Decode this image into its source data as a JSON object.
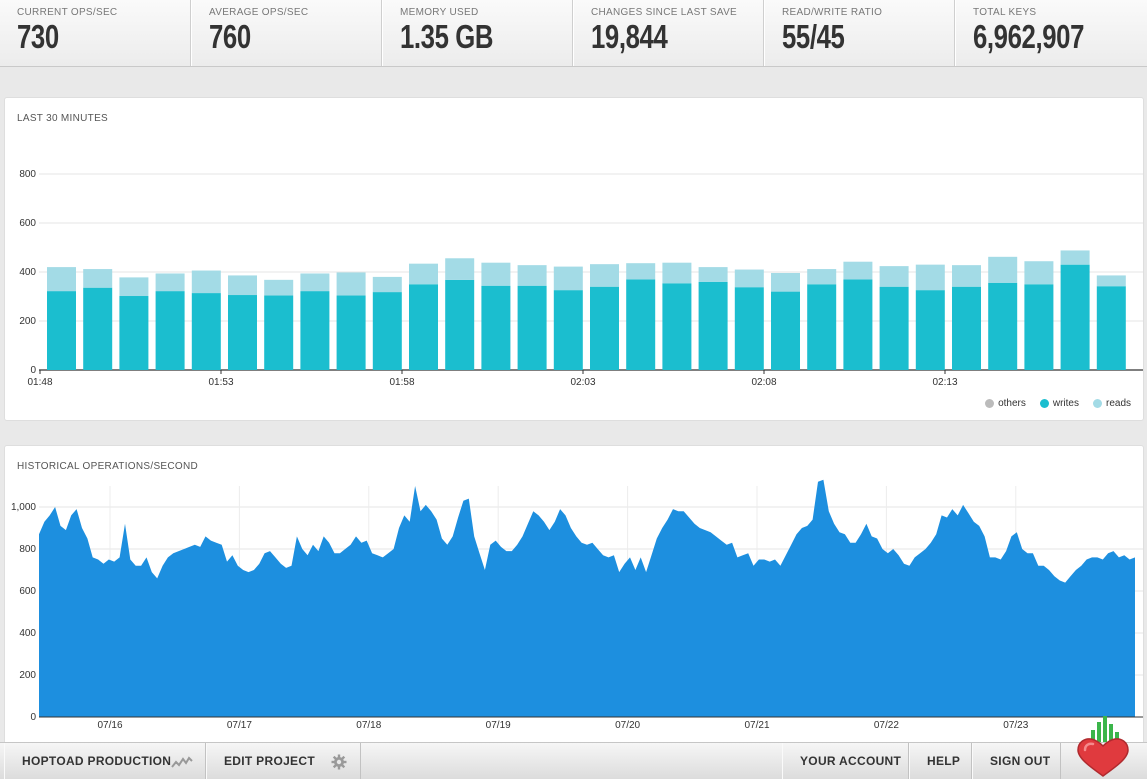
{
  "stats": [
    {
      "label": "CURRENT OPS/SEC",
      "value": "730"
    },
    {
      "label": "AVERAGE OPS/SEC",
      "value": "760"
    },
    {
      "label": "MEMORY USED",
      "value": "1.35 GB"
    },
    {
      "label": "CHANGES SINCE LAST SAVE",
      "value": "19,844"
    },
    {
      "label": "READ/WRITE RATIO",
      "value": "55/45"
    },
    {
      "label": "TOTAL KEYS",
      "value": "6,962,907"
    }
  ],
  "colors": {
    "writes": "#1bbecf",
    "reads": "#a3dbe6",
    "others": "#bbbbbb",
    "historical": "#1d8fdf"
  },
  "chart_data": [
    {
      "type": "bar",
      "title": "LAST 30 MINUTES",
      "stacked": true,
      "ylim": [
        0,
        800
      ],
      "yticks": [
        "0",
        "200",
        "400",
        "600",
        "800"
      ],
      "xtick_labels": [
        "01:48",
        "01:53",
        "01:58",
        "02:03",
        "02:08",
        "02:13"
      ],
      "legend": [
        "others",
        "writes",
        "reads"
      ],
      "legend_position": "bottom-right",
      "grid": true,
      "series": [
        {
          "name": "writes",
          "values": [
            322,
            336,
            302,
            322,
            314,
            306,
            304,
            322,
            304,
            318,
            350,
            368,
            344,
            344,
            326,
            340,
            370,
            354,
            360,
            338,
            320,
            350,
            370,
            340,
            326,
            340,
            356,
            350,
            430,
            342
          ]
        },
        {
          "name": "reads",
          "values": [
            98,
            76,
            76,
            72,
            92,
            80,
            64,
            72,
            94,
            62,
            84,
            88,
            94,
            84,
            96,
            92,
            66,
            84,
            60,
            72,
            76,
            62,
            72,
            84,
            104,
            88,
            106,
            94,
            58,
            44
          ]
        }
      ]
    },
    {
      "type": "area",
      "title": "HISTORICAL OPERATIONS/SECOND",
      "ylim": [
        0,
        1100
      ],
      "yticks": [
        "0",
        "200",
        "400",
        "600",
        "800",
        "1,000"
      ],
      "xtick_labels": [
        "07/16",
        "07/17",
        "07/18",
        "07/19",
        "07/20",
        "07/21",
        "07/22",
        "07/23"
      ],
      "grid": true,
      "values": [
        870,
        930,
        960,
        1000,
        910,
        890,
        960,
        990,
        900,
        850,
        760,
        750,
        730,
        750,
        740,
        760,
        920,
        750,
        720,
        720,
        760,
        690,
        660,
        720,
        760,
        780,
        790,
        800,
        810,
        820,
        810,
        860,
        840,
        830,
        820,
        740,
        770,
        720,
        700,
        690,
        700,
        730,
        780,
        790,
        760,
        730,
        710,
        720,
        860,
        800,
        770,
        820,
        790,
        860,
        830,
        780,
        780,
        800,
        820,
        860,
        830,
        840,
        780,
        770,
        760,
        780,
        800,
        900,
        960,
        930,
        1100,
        980,
        1010,
        980,
        940,
        850,
        820,
        860,
        950,
        1030,
        1040,
        860,
        780,
        700,
        820,
        840,
        810,
        790,
        790,
        820,
        860,
        920,
        980,
        960,
        930,
        890,
        930,
        990,
        960,
        900,
        860,
        830,
        820,
        830,
        800,
        770,
        760,
        770,
        690,
        730,
        760,
        700,
        760,
        690,
        770,
        850,
        900,
        940,
        990,
        980,
        980,
        950,
        920,
        900,
        890,
        880,
        860,
        840,
        820,
        830,
        760,
        770,
        780,
        720,
        750,
        750,
        740,
        750,
        720,
        770,
        820,
        870,
        900,
        910,
        940,
        1120,
        1130,
        980,
        920,
        880,
        870,
        830,
        830,
        870,
        920,
        860,
        850,
        800,
        780,
        800,
        770,
        730,
        720,
        760,
        780,
        800,
        830,
        870,
        960,
        950,
        990,
        960,
        1010,
        970,
        930,
        910,
        860,
        760,
        760,
        750,
        790,
        860,
        880,
        800,
        780,
        780,
        720,
        720,
        700,
        670,
        650,
        640,
        670,
        700,
        720,
        750,
        760,
        760,
        750,
        780,
        790,
        760,
        770,
        750,
        760
      ]
    }
  ],
  "nav": {
    "project": "HOPTOAD PRODUCTION",
    "edit": "EDIT PROJECT",
    "account": "YOUR ACCOUNT",
    "help": "HELP",
    "signout": "SIGN OUT"
  }
}
